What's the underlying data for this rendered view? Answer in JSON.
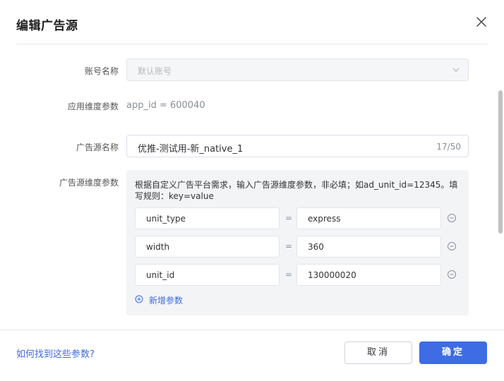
{
  "dialog": {
    "title": "编辑广告源",
    "close_icon": "close-icon"
  },
  "form": {
    "account": {
      "label": "账号名称",
      "value": "默认账号",
      "icon": "chevron-down-icon"
    },
    "app_params": {
      "label": "应用维度参数",
      "value": "app_id = 600040"
    },
    "source_name": {
      "label": "广告源名称",
      "value": "优推-测试用-新_native_1",
      "counter": "17/50"
    },
    "source_params": {
      "label": "广告源维度参数",
      "hint": "根据自定义广告平台需求，输入广告源维度参数，非必填；如ad_unit_id=12345。填写规则：key=value",
      "equals": "=",
      "rows": [
        {
          "key": "unit_type",
          "value": "express"
        },
        {
          "key": "width",
          "value": "360"
        },
        {
          "key": "unit_id",
          "value": "130000020"
        }
      ],
      "add_label": "新增参数"
    }
  },
  "footer": {
    "help_link": "如何找到这些参数?",
    "cancel_label": "取消",
    "ok_label": "确定"
  },
  "colors": {
    "primary": "#3d6ce5",
    "link": "#3f6ae0",
    "muted": "#8a8f98"
  }
}
